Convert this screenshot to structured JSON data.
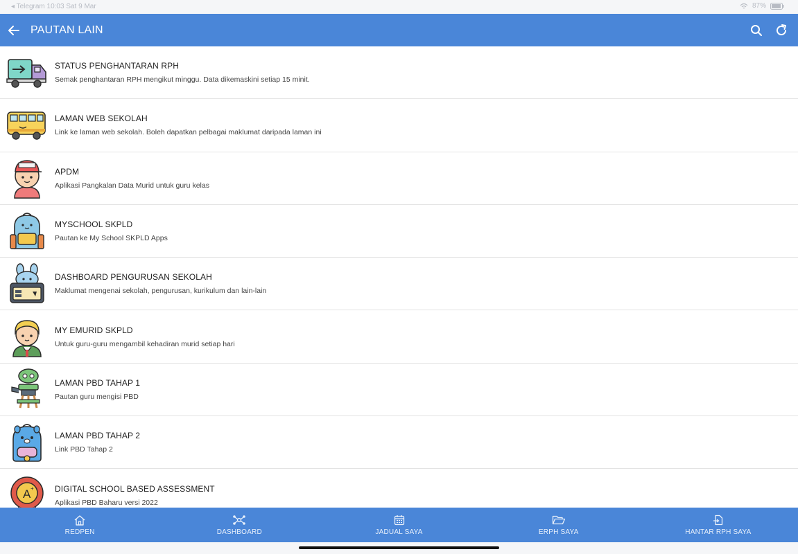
{
  "status_bar": {
    "left_text": "◂ Telegram  10:03  Sat 9 Mar",
    "right_text": "87%"
  },
  "header": {
    "title": "PAUTAN LAIN",
    "back_icon": "arrow-left-icon",
    "search_icon": "search-icon",
    "refresh_icon": "refresh-icon",
    "color": "#4a86d8"
  },
  "items": [
    {
      "title": "STATUS PENGHANTARAN RPH",
      "subtitle": "Semak penghantaran RPH mengikut minggu. Data dikemaskini setiap 15 minit.",
      "icon": "delivery-truck-icon"
    },
    {
      "title": "LAMAN WEB SEKOLAH",
      "subtitle": "Link ke laman web sekolah. Boleh dapatkan pelbagai maklumat daripada laman ini",
      "icon": "school-bus-icon"
    },
    {
      "title": "APDM",
      "subtitle": "Aplikasi Pangkalan Data Murid untuk guru kelas",
      "icon": "student-boy-icon"
    },
    {
      "title": "MYSCHOOL SKPLD",
      "subtitle": "Pautan ke My School SKPLD Apps",
      "icon": "backpack-icon"
    },
    {
      "title": "DASHBOARD PENGURUSAN SEKOLAH",
      "subtitle": "Maklumat mengenai sekolah, pengurusan, kurikulum dan lain-lain",
      "icon": "pencil-case-icon"
    },
    {
      "title": "MY EMURID SKPLD",
      "subtitle": "Untuk guru-guru mengambil kehadiran murid setiap hari",
      "icon": "student-girl-icon"
    },
    {
      "title": "LAMAN PBD TAHAP 1",
      "subtitle": "Pautan guru mengisi PBD",
      "icon": "school-desk-icon"
    },
    {
      "title": "LAMAN PBD TAHAP 2",
      "subtitle": "Link PBD Tahap 2",
      "icon": "blue-backpack-icon"
    },
    {
      "title": "DIGITAL SCHOOL BASED ASSESSMENT",
      "subtitle": "Aplikasi PBD Baharu versi 2022",
      "icon": "grade-badge-icon"
    }
  ],
  "nav": [
    {
      "label": "REDPEN",
      "icon": "home-icon"
    },
    {
      "label": "DASHBOARD",
      "icon": "network-icon"
    },
    {
      "label": "JADUAL SAYA",
      "icon": "calendar-icon"
    },
    {
      "label": "ERPH SAYA",
      "icon": "folder-open-icon"
    },
    {
      "label": "HANTAR RPH SAYA",
      "icon": "file-send-icon"
    }
  ]
}
